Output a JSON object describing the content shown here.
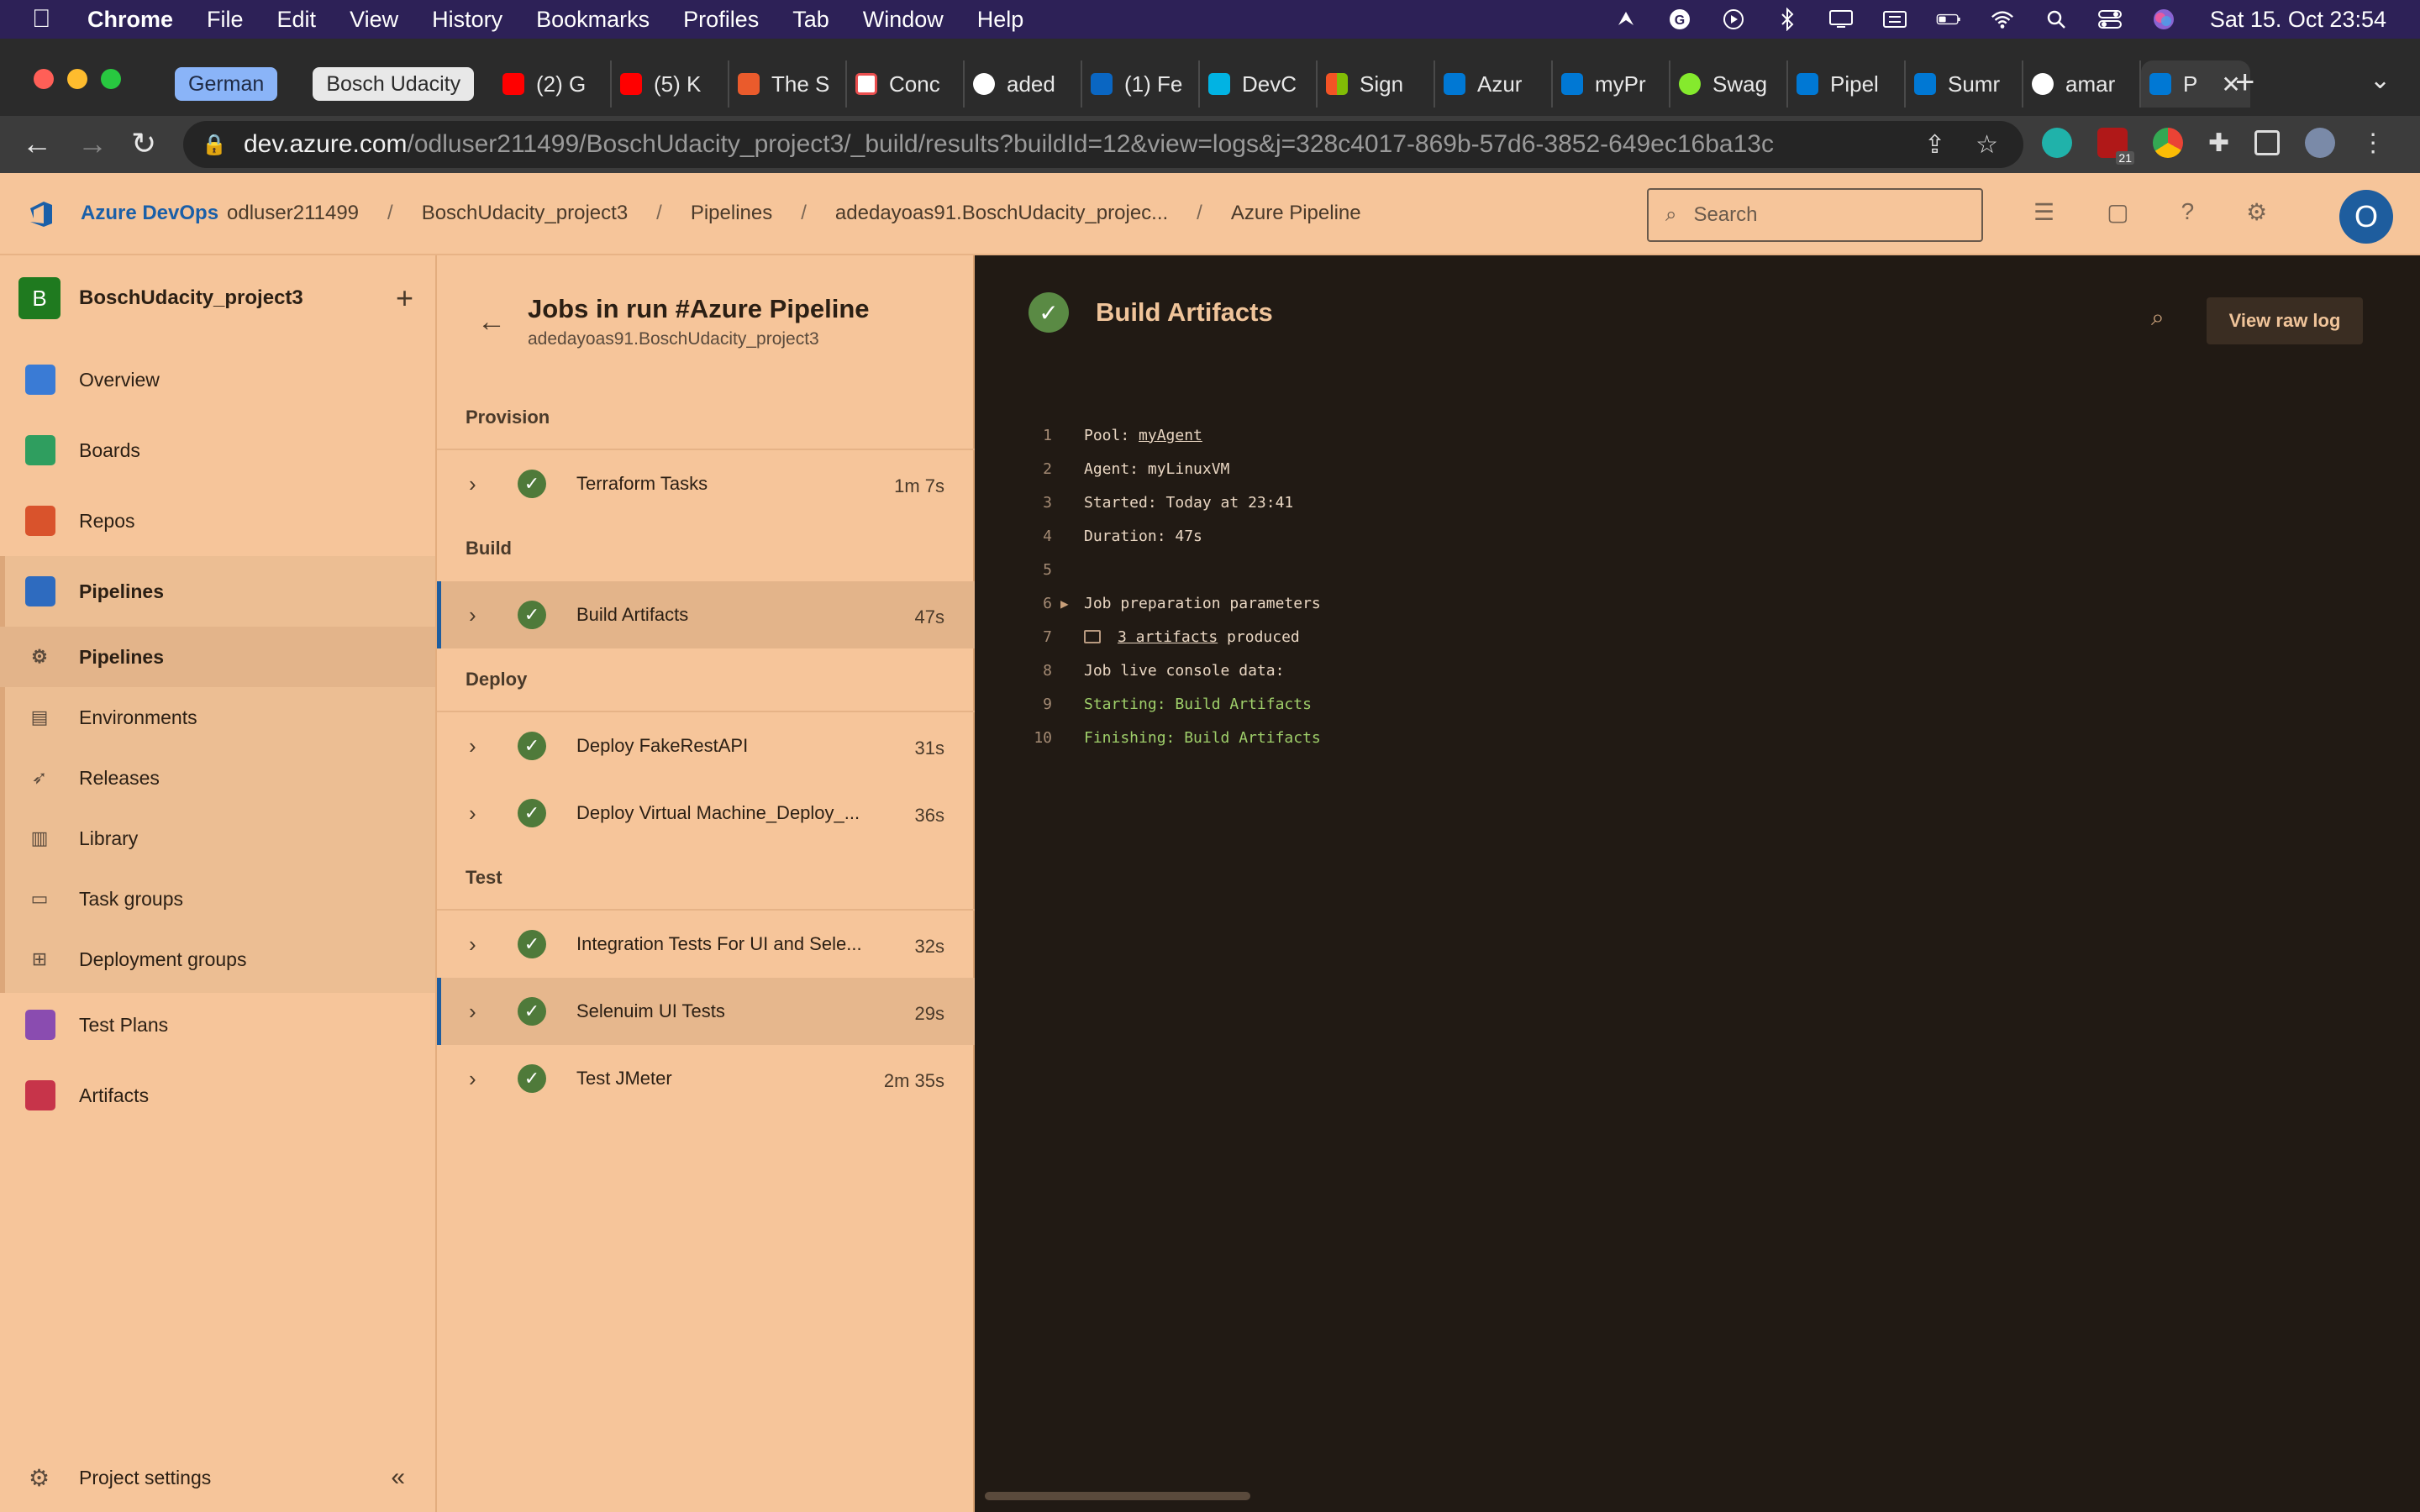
{
  "menubar": {
    "app": "Chrome",
    "items": [
      "File",
      "Edit",
      "View",
      "History",
      "Bookmarks",
      "Profiles",
      "Tab",
      "Window",
      "Help"
    ],
    "clock": "Sat 15. Oct  23:54"
  },
  "tabstrip": {
    "groups": [
      "German",
      "Bosch Udacity"
    ],
    "tabs": [
      {
        "label": "(2) G",
        "color": "#ff0000"
      },
      {
        "label": "(5) K",
        "color": "#ff0000"
      },
      {
        "label": "The S",
        "color": "#ea5b2c"
      },
      {
        "label": "Conc",
        "color": "#e94e4e"
      },
      {
        "label": "aded",
        "color": "#ffffff"
      },
      {
        "label": "(1) Fe",
        "color": "#0a66c2"
      },
      {
        "label": "DevC",
        "color": "#01b3e3"
      },
      {
        "label": "Sign",
        "color": "#f35325"
      },
      {
        "label": "Azur",
        "color": "#0078d4"
      },
      {
        "label": "myPr",
        "color": "#0078d4"
      },
      {
        "label": "Swag",
        "color": "#85ea2d"
      },
      {
        "label": "Pipel",
        "color": "#0078d4"
      },
      {
        "label": "Sumr",
        "color": "#0078d4"
      },
      {
        "label": "amar",
        "color": "#ffffff"
      }
    ],
    "active_tab": "P"
  },
  "toolbar": {
    "url_host": "dev.azure.com",
    "url_path": "/odluser211499/BoschUdacity_project3/_build/results?buildId=12&view=logs&j=328c4017-869b-57d6-3852-649ec16ba13c",
    "ext_badge": "21"
  },
  "azheader": {
    "brand": "Azure DevOps",
    "breadcrumbs": [
      "odluser211499",
      "BoschUdacity_project3",
      "Pipelines",
      "adedayoas91.BoschUdacity_projec...",
      "Azure Pipeline"
    ],
    "search_placeholder": "Search",
    "avatar": "O"
  },
  "leftnav": {
    "project_badge": "B",
    "project_name": "BoschUdacity_project3",
    "items": [
      "Overview",
      "Boards",
      "Repos",
      "Pipelines",
      "Pipelines",
      "Environments",
      "Releases",
      "Library",
      "Task groups",
      "Deployment groups",
      "Test Plans",
      "Artifacts"
    ],
    "settings": "Project settings"
  },
  "jobs": {
    "title": "Jobs in run #Azure Pipeline",
    "subtitle": "adedayoas91.BoschUdacity_project3",
    "stages": [
      {
        "name": "Provision",
        "jobs": [
          {
            "name": "Terraform Tasks",
            "duration": "1m 7s"
          }
        ]
      },
      {
        "name": "Build",
        "jobs": [
          {
            "name": "Build Artifacts",
            "duration": "47s"
          }
        ]
      },
      {
        "name": "Deploy",
        "jobs": [
          {
            "name": "Deploy FakeRestAPI",
            "duration": "31s"
          },
          {
            "name": "Deploy Virtual Machine_Deploy_...",
            "duration": "36s"
          }
        ]
      },
      {
        "name": "Test",
        "jobs": [
          {
            "name": "Integration Tests For UI and Sele...",
            "duration": "32s"
          },
          {
            "name": "Selenuim UI Tests",
            "duration": "29s"
          },
          {
            "name": "Test JMeter",
            "duration": "2m 35s"
          }
        ]
      }
    ]
  },
  "log": {
    "title": "Build Artifacts",
    "raw_button": "View raw log",
    "lines": [
      {
        "n": "1",
        "pre": "Pool: ",
        "link": "myAgent",
        "post": ""
      },
      {
        "n": "2",
        "text": "Agent: myLinuxVM"
      },
      {
        "n": "3",
        "text": "Started: Today at 23:41"
      },
      {
        "n": "4",
        "text": "Duration: 47s"
      },
      {
        "n": "5",
        "text": ""
      },
      {
        "n": "6",
        "text": "Job preparation parameters"
      },
      {
        "n": "7",
        "link": "3 artifacts",
        "post": " produced"
      },
      {
        "n": "8",
        "text": "Job live console data:"
      },
      {
        "n": "9",
        "text": "Starting: Build Artifacts"
      },
      {
        "n": "10",
        "text": "Finishing: Build Artifacts"
      }
    ]
  }
}
